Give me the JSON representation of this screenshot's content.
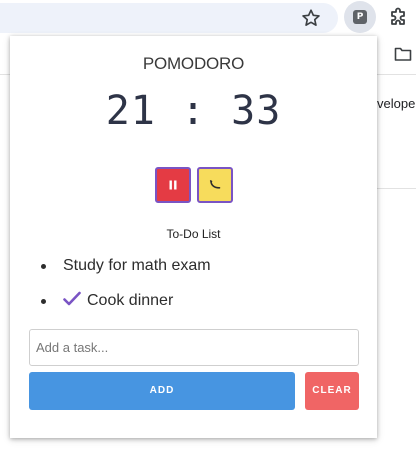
{
  "browser": {
    "extension_badge": "P",
    "page_text": "veloper"
  },
  "popup": {
    "title": "POMODORO",
    "timer": {
      "minutes": "21",
      "separator": ":",
      "seconds": "33",
      "display": "21 : 33"
    },
    "controls": [
      {
        "name": "pause",
        "icon": "pause-icon",
        "color": "#e43b44"
      },
      {
        "name": "break",
        "icon": "banana-icon",
        "color": "#f7dc5c"
      }
    ],
    "todo_title": "To-Do List",
    "todos": [
      {
        "text": "Study for math exam",
        "done": false
      },
      {
        "text": "Cook dinner",
        "done": true
      }
    ],
    "input": {
      "value": "",
      "placeholder": "Add a task..."
    },
    "add_label": "ADD",
    "clear_label": "CLEAR"
  },
  "colors": {
    "accent_blue": "#4795e1",
    "clear_red": "#f06565",
    "check_purple": "#7a54c4"
  }
}
